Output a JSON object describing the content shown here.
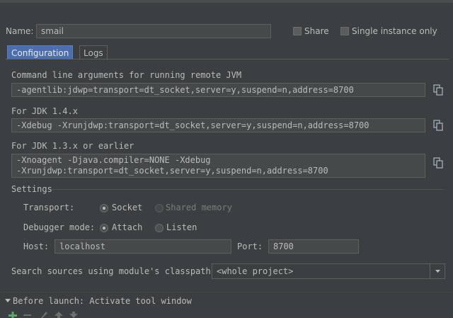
{
  "name": {
    "label": "Name:",
    "value": "smail"
  },
  "share": {
    "label": "Share",
    "checked": false
  },
  "single_instance": {
    "label": "Single instance only",
    "checked": false
  },
  "tabs": [
    {
      "label": "Configuration",
      "active": true
    },
    {
      "label": "Logs",
      "active": false
    }
  ],
  "jvm_args": {
    "label": "Command line arguments for running remote JVM",
    "value": "-agentlib:jdwp=transport=dt_socket,server=y,suspend=n,address=8700"
  },
  "jdk14": {
    "label": "For JDK 1.4.x",
    "value": "-Xdebug -Xrunjdwp:transport=dt_socket,server=y,suspend=n,address=8700"
  },
  "jdk13": {
    "label": "For JDK 1.3.x or earlier",
    "line1": "-Xnoagent -Djava.compiler=NONE -Xdebug",
    "line2": "-Xrunjdwp:transport=dt_socket,server=y,suspend=n,address=8700"
  },
  "settings": {
    "title": "Settings",
    "transport": {
      "label": "Transport:",
      "options": [
        "Socket",
        "Shared memory"
      ],
      "selected": "Socket"
    },
    "debugger_mode": {
      "label": "Debugger mode:",
      "options": [
        "Attach",
        "Listen"
      ],
      "selected": "Attach"
    },
    "host": {
      "label": "Host:",
      "value": "localhost"
    },
    "port": {
      "label": "Port:",
      "value": "8700"
    }
  },
  "search_sources": {
    "label": "Search sources using module's classpath:",
    "value": "<whole project>"
  },
  "before_launch": {
    "label": "Before launch: Activate tool window"
  },
  "colors": {
    "background": "#3c3f41",
    "accent": "#4b6eaf",
    "add": "#59a869"
  }
}
